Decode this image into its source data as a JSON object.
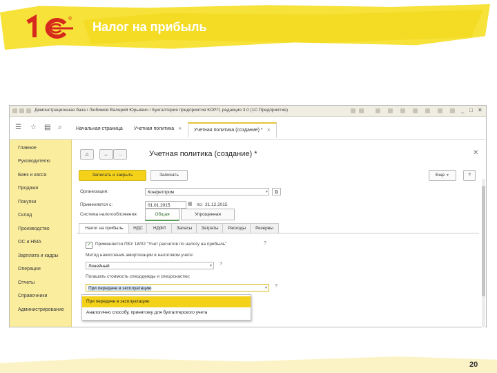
{
  "slide": {
    "title": "Налог на прибыль",
    "page_number": "20",
    "logo_text": "1С"
  },
  "window": {
    "title": "Демонстрационная база / Любимов Валерий Юрьевич / Бухгалтерия предприятия КОРП, редакция 3.0 (1С:Предприятие)",
    "tabs": [
      {
        "label": "Начальная страница"
      },
      {
        "label": "Учетная политика"
      },
      {
        "label": "Учетная политика (создание) *"
      }
    ]
  },
  "sidebar": {
    "items": [
      {
        "label": "Главное"
      },
      {
        "label": "Руководителю"
      },
      {
        "label": "Банк и касса"
      },
      {
        "label": "Продажи"
      },
      {
        "label": "Покупки"
      },
      {
        "label": "Склад"
      },
      {
        "label": "Производство"
      },
      {
        "label": "ОС и НМА"
      },
      {
        "label": "Зарплата и кадры"
      },
      {
        "label": "Операции"
      },
      {
        "label": "Отчеты"
      },
      {
        "label": "Справочники"
      },
      {
        "label": "Администрирование"
      }
    ]
  },
  "form": {
    "title": "Учетная политика (создание) *",
    "btn_save_close": "Записать и закрыть",
    "btn_save": "Записать",
    "btn_more": "Еще",
    "btn_help": "?",
    "org_label": "Организация:",
    "org_value": "Конфетпром",
    "apply_label": "Применяется с:",
    "apply_from": "01.01.2015",
    "apply_to_label": "по:",
    "apply_to": "31.12.2015",
    "tax_system_label": "Система налогообложения:",
    "tax_options": [
      {
        "label": "Общая"
      },
      {
        "label": "Упрощенная"
      }
    ],
    "inner_tabs": [
      {
        "label": "Налог на прибыль"
      },
      {
        "label": "НДС"
      },
      {
        "label": "НДФЛ"
      },
      {
        "label": "Запасы"
      },
      {
        "label": "Затраты"
      },
      {
        "label": "Расходы"
      },
      {
        "label": "Резервы"
      }
    ],
    "pbu_checkbox_label": "Применяется ПБУ 18/02 \"Учет расчетов по налогу на прибыль\"",
    "method_label": "Метод начисления амортизации в налоговом учете:",
    "method_value": "Линейный",
    "repay_label": "Погашать стоимость спецодежды и спецоснастки:",
    "repay_value": "При передаче в эксплуатацию",
    "dropdown_options": [
      {
        "label": "При передаче в эксплуатацию"
      },
      {
        "label": "Аналогично способу, принятому для бухгалтерского учета"
      }
    ]
  },
  "colors": {
    "accent_yellow": "#f5d21a",
    "sidebar_bg": "#fbed9e",
    "slide_brush": "#f7e23a",
    "logo_red": "#d6281c"
  }
}
